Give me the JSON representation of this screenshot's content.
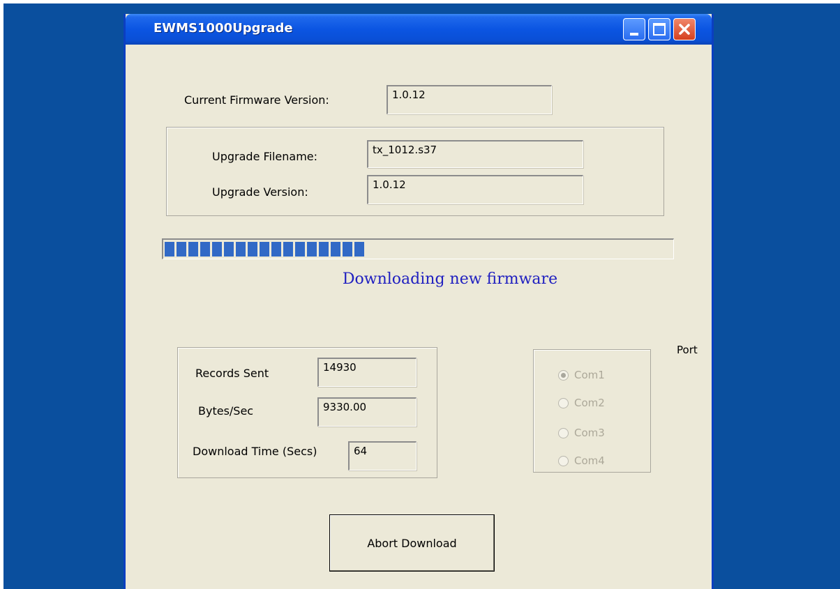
{
  "window": {
    "title": "EWMS1000Upgrade"
  },
  "firmware": {
    "current_label": "Current Firmware Version:",
    "current_value": "1.0.12"
  },
  "upgrade": {
    "filename_label": "Upgrade Filename:",
    "filename_value": "tx_1012.s37",
    "version_label": "Upgrade Version:",
    "version_value": "1.0.12"
  },
  "progress": {
    "percent": 42,
    "status": "Downloading new firmware"
  },
  "stats": {
    "records_label": "Records Sent",
    "records_value": "14930",
    "rate_label": "Bytes/Sec",
    "rate_value": "9330.00",
    "time_label": "Download Time (Secs)",
    "time_value": "64"
  },
  "port": {
    "legend": "Port",
    "options": [
      {
        "label": "Com1",
        "checked": true
      },
      {
        "label": "Com2",
        "checked": false
      },
      {
        "label": "Com3",
        "checked": false
      },
      {
        "label": "Com4",
        "checked": false
      }
    ]
  },
  "actions": {
    "abort_label": "Abort Download"
  },
  "colors": {
    "titlebar": "#0a55e2",
    "desktop": "#0a4f9e",
    "progress": "#3169c6",
    "status_text": "#2020c0"
  }
}
